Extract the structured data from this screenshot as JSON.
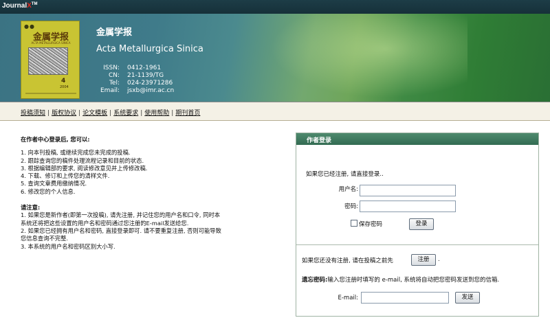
{
  "topbar": {
    "brand_prefix": "Journal",
    "brand_x": "X",
    "brand_tm": "TM"
  },
  "banner": {
    "cover": {
      "dots": "●●",
      "title": "金属学报",
      "subtitle": "ACTA METALLURGICA SINICA",
      "issue": "4",
      "year": "2004"
    },
    "title_cn": "金属学报",
    "title_en": "Acta Metallurgica Sinica",
    "info": [
      {
        "label": "ISSN:",
        "value": "0412-1961"
      },
      {
        "label": "CN:",
        "value": "21-1139/TG"
      },
      {
        "label": "Tel:",
        "value": "024-23971286"
      },
      {
        "label": "Email:",
        "value": "jsxb@imr.ac.cn"
      }
    ]
  },
  "nav": {
    "items": [
      "投稿须知",
      "版权协议",
      "论文模板",
      "系统要求",
      "使用帮助",
      "期刊首页"
    ],
    "separator": "|"
  },
  "left": {
    "heading": "在作者中心登录后, 您可以:",
    "abilities": [
      "1. 向本刊投稿, 或继续完成您未完成的投稿.",
      "2. 跟踪查询您的稿件处理流程记录和目前的状态.",
      "3. 根据编辑部的要求, 阅读修改意见并上传修改稿.",
      "4. 下载、修订和上传您的清样文件.",
      "5. 查询文章费用缴纳情况.",
      "6. 修改您的个人信息."
    ],
    "notice_heading": "请注意:",
    "notices": [
      "1. 如果您是新作者(即第一次投稿), 请先注册, 并记住您的用户名和口令, 同时本",
      "系统还将把这些设置的用户名和密码通过您注册的E-mail发送给您.",
      "2. 如果您已经拥有用户名和密码, 直接登录即可. 请不要重复注册, 否则可能导致",
      "您信息查询不完整.",
      "3. 本系统的用户名和密码区别大小写."
    ]
  },
  "login": {
    "title": "作者登录",
    "intro": "如果您已经注册, 请直接登录..",
    "username_label": "用户名:",
    "username_value": "",
    "password_label": "密码:",
    "password_value": "",
    "save_password_label": "保存密码",
    "save_password_checked": false,
    "login_button": "登录",
    "register_prefix": "如果您还没有注册, 请在投稿之前先",
    "register_button": "注册",
    "register_suffix": ".",
    "forgot_bold": "遗忘密码:",
    "forgot_text": "输入您注册时填写的 e-mail, 系统将自动把您密码发送到您的信箱.",
    "email_label": "E-mail:",
    "email_value": "",
    "send_button": "发送"
  }
}
